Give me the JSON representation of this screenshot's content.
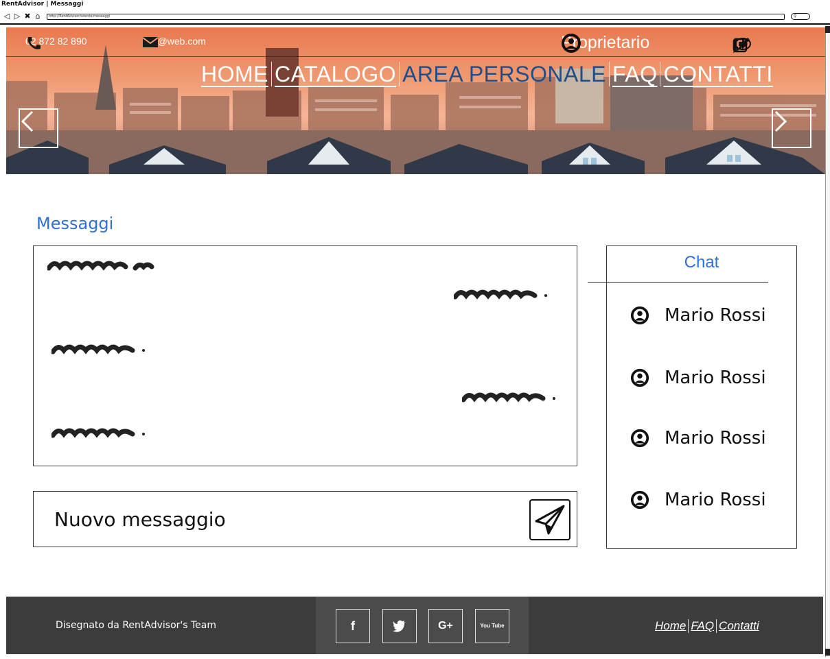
{
  "browser": {
    "title": "RentAdvisor | Messaggi",
    "url": "http://RentAdvisor/utente/messaggi"
  },
  "header": {
    "phone": "02 872 82 890",
    "email": "info@web.com",
    "role": "Proprietario"
  },
  "nav": {
    "items": [
      {
        "label": "HOME"
      },
      {
        "label": "CATALOGO"
      },
      {
        "label": "AREA PERSONALE"
      },
      {
        "label": "FAQ"
      },
      {
        "label": "CONTATTI"
      }
    ],
    "active": "AREA PERSONALE"
  },
  "messages": {
    "title": "Messaggi",
    "compose_placeholder": "Nuovo messaggio"
  },
  "chat": {
    "title": "Chat",
    "contacts": [
      {
        "name": "Mario Rossi"
      },
      {
        "name": "Mario Rossi"
      },
      {
        "name": "Mario Rossi"
      },
      {
        "name": "Mario Rossi"
      }
    ]
  },
  "footer": {
    "credit": "Disegnato da RentAdvisor's Team",
    "social": [
      "f",
      "twitter",
      "G+",
      "You Tube"
    ],
    "links": [
      "Home",
      "FAQ",
      "Contatti"
    ]
  },
  "colors": {
    "accent": "#2f6fd6",
    "nav_active": "#1f4f8a",
    "footer": "#3c3c3c"
  }
}
